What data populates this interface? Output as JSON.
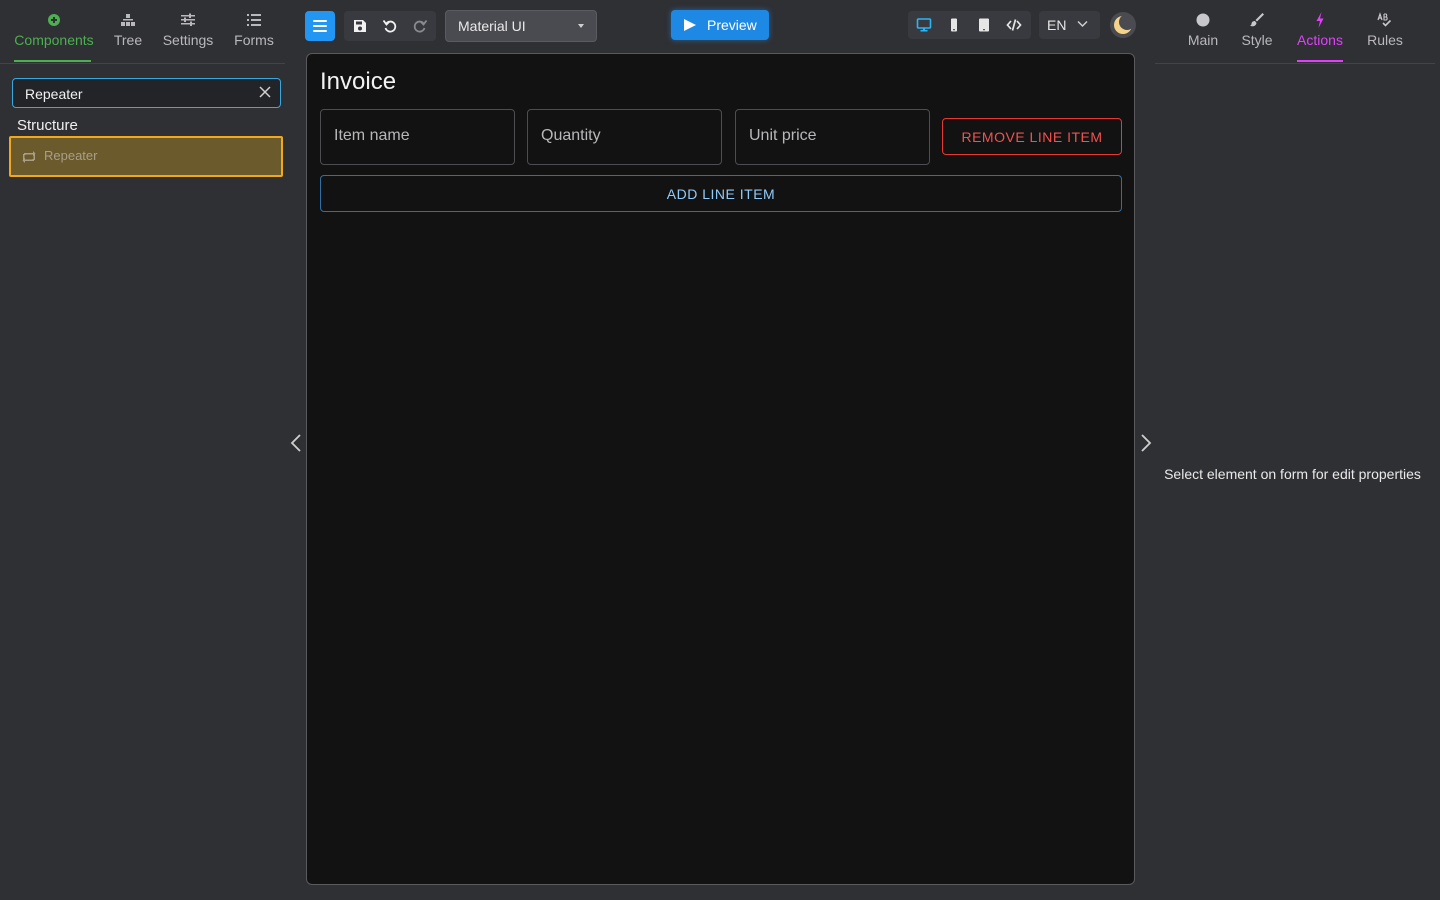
{
  "left_panel": {
    "tabs": [
      {
        "label": "Components",
        "icon": "plus-circle-icon"
      },
      {
        "label": "Tree",
        "icon": "tree-icon"
      },
      {
        "label": "Settings",
        "icon": "sliders-icon"
      },
      {
        "label": "Forms",
        "icon": "list-icon"
      }
    ],
    "active_tab": "Components",
    "search": {
      "value": "Repeater",
      "placeholder": ""
    },
    "section_title": "Structure",
    "items": [
      {
        "label": "Repeater",
        "icon": "repeater-icon"
      }
    ]
  },
  "toolbar": {
    "theme_select": {
      "value": "Material UI"
    },
    "preview_label": "Preview",
    "language": "EN"
  },
  "canvas": {
    "form_title": "Invoice",
    "fields": [
      {
        "placeholder": "Item name"
      },
      {
        "placeholder": "Quantity"
      },
      {
        "placeholder": "Unit price"
      }
    ],
    "remove_button": "REMOVE LINE ITEM",
    "add_button": "ADD LINE ITEM"
  },
  "right_panel": {
    "tabs": [
      {
        "label": "Main",
        "icon": "circle-icon"
      },
      {
        "label": "Style",
        "icon": "brush-icon"
      },
      {
        "label": "Actions",
        "icon": "lightning-icon"
      },
      {
        "label": "Rules",
        "icon": "ab-check-icon"
      }
    ],
    "active_tab": "Actions",
    "hint": "Select element on form for edit properties"
  },
  "colors": {
    "accent_green": "#4caf50",
    "accent_blue": "#2196f3",
    "accent_purple": "#e040fb",
    "danger": "#e53935",
    "highlight": "#f0a81c"
  }
}
